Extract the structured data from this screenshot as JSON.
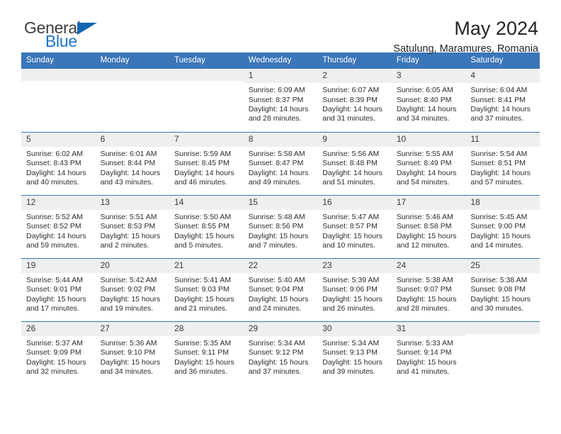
{
  "logo": {
    "word_one": "General",
    "word_two": "Blue",
    "triangle_icon": "triangle-icon",
    "color_dark": "#3c3c3c",
    "color_blue": "#1e74c4"
  },
  "header": {
    "title": "May 2024",
    "subtitle": "Satulung, Maramures, Romania"
  },
  "theme": {
    "header_blue": "#3a76b8",
    "daynum_bg": "#efefef",
    "text": "#2c2c2c"
  },
  "calendar": {
    "weekday_headers": [
      "Sunday",
      "Monday",
      "Tuesday",
      "Wednesday",
      "Thursday",
      "Friday",
      "Saturday"
    ],
    "labels": {
      "sunrise": "Sunrise:",
      "sunset": "Sunset:",
      "daylight": "Daylight:"
    },
    "weeks": [
      [
        {
          "day": "",
          "empty": true
        },
        {
          "day": "",
          "empty": true
        },
        {
          "day": "",
          "empty": true
        },
        {
          "day": "1",
          "sunrise": "Sunrise: 6:09 AM",
          "sunset": "Sunset: 8:37 PM",
          "daylight_1": "Daylight: 14 hours",
          "daylight_2": "and 28 minutes."
        },
        {
          "day": "2",
          "sunrise": "Sunrise: 6:07 AM",
          "sunset": "Sunset: 8:39 PM",
          "daylight_1": "Daylight: 14 hours",
          "daylight_2": "and 31 minutes."
        },
        {
          "day": "3",
          "sunrise": "Sunrise: 6:05 AM",
          "sunset": "Sunset: 8:40 PM",
          "daylight_1": "Daylight: 14 hours",
          "daylight_2": "and 34 minutes."
        },
        {
          "day": "4",
          "sunrise": "Sunrise: 6:04 AM",
          "sunset": "Sunset: 8:41 PM",
          "daylight_1": "Daylight: 14 hours",
          "daylight_2": "and 37 minutes."
        }
      ],
      [
        {
          "day": "5",
          "sunrise": "Sunrise: 6:02 AM",
          "sunset": "Sunset: 8:43 PM",
          "daylight_1": "Daylight: 14 hours",
          "daylight_2": "and 40 minutes."
        },
        {
          "day": "6",
          "sunrise": "Sunrise: 6:01 AM",
          "sunset": "Sunset: 8:44 PM",
          "daylight_1": "Daylight: 14 hours",
          "daylight_2": "and 43 minutes."
        },
        {
          "day": "7",
          "sunrise": "Sunrise: 5:59 AM",
          "sunset": "Sunset: 8:45 PM",
          "daylight_1": "Daylight: 14 hours",
          "daylight_2": "and 46 minutes."
        },
        {
          "day": "8",
          "sunrise": "Sunrise: 5:58 AM",
          "sunset": "Sunset: 8:47 PM",
          "daylight_1": "Daylight: 14 hours",
          "daylight_2": "and 49 minutes."
        },
        {
          "day": "9",
          "sunrise": "Sunrise: 5:56 AM",
          "sunset": "Sunset: 8:48 PM",
          "daylight_1": "Daylight: 14 hours",
          "daylight_2": "and 51 minutes."
        },
        {
          "day": "10",
          "sunrise": "Sunrise: 5:55 AM",
          "sunset": "Sunset: 8:49 PM",
          "daylight_1": "Daylight: 14 hours",
          "daylight_2": "and 54 minutes."
        },
        {
          "day": "11",
          "sunrise": "Sunrise: 5:54 AM",
          "sunset": "Sunset: 8:51 PM",
          "daylight_1": "Daylight: 14 hours",
          "daylight_2": "and 57 minutes."
        }
      ],
      [
        {
          "day": "12",
          "sunrise": "Sunrise: 5:52 AM",
          "sunset": "Sunset: 8:52 PM",
          "daylight_1": "Daylight: 14 hours",
          "daylight_2": "and 59 minutes."
        },
        {
          "day": "13",
          "sunrise": "Sunrise: 5:51 AM",
          "sunset": "Sunset: 8:53 PM",
          "daylight_1": "Daylight: 15 hours",
          "daylight_2": "and 2 minutes."
        },
        {
          "day": "14",
          "sunrise": "Sunrise: 5:50 AM",
          "sunset": "Sunset: 8:55 PM",
          "daylight_1": "Daylight: 15 hours",
          "daylight_2": "and 5 minutes."
        },
        {
          "day": "15",
          "sunrise": "Sunrise: 5:48 AM",
          "sunset": "Sunset: 8:56 PM",
          "daylight_1": "Daylight: 15 hours",
          "daylight_2": "and 7 minutes."
        },
        {
          "day": "16",
          "sunrise": "Sunrise: 5:47 AM",
          "sunset": "Sunset: 8:57 PM",
          "daylight_1": "Daylight: 15 hours",
          "daylight_2": "and 10 minutes."
        },
        {
          "day": "17",
          "sunrise": "Sunrise: 5:46 AM",
          "sunset": "Sunset: 8:58 PM",
          "daylight_1": "Daylight: 15 hours",
          "daylight_2": "and 12 minutes."
        },
        {
          "day": "18",
          "sunrise": "Sunrise: 5:45 AM",
          "sunset": "Sunset: 9:00 PM",
          "daylight_1": "Daylight: 15 hours",
          "daylight_2": "and 14 minutes."
        }
      ],
      [
        {
          "day": "19",
          "sunrise": "Sunrise: 5:44 AM",
          "sunset": "Sunset: 9:01 PM",
          "daylight_1": "Daylight: 15 hours",
          "daylight_2": "and 17 minutes."
        },
        {
          "day": "20",
          "sunrise": "Sunrise: 5:42 AM",
          "sunset": "Sunset: 9:02 PM",
          "daylight_1": "Daylight: 15 hours",
          "daylight_2": "and 19 minutes."
        },
        {
          "day": "21",
          "sunrise": "Sunrise: 5:41 AM",
          "sunset": "Sunset: 9:03 PM",
          "daylight_1": "Daylight: 15 hours",
          "daylight_2": "and 21 minutes."
        },
        {
          "day": "22",
          "sunrise": "Sunrise: 5:40 AM",
          "sunset": "Sunset: 9:04 PM",
          "daylight_1": "Daylight: 15 hours",
          "daylight_2": "and 24 minutes."
        },
        {
          "day": "23",
          "sunrise": "Sunrise: 5:39 AM",
          "sunset": "Sunset: 9:06 PM",
          "daylight_1": "Daylight: 15 hours",
          "daylight_2": "and 26 minutes."
        },
        {
          "day": "24",
          "sunrise": "Sunrise: 5:38 AM",
          "sunset": "Sunset: 9:07 PM",
          "daylight_1": "Daylight: 15 hours",
          "daylight_2": "and 28 minutes."
        },
        {
          "day": "25",
          "sunrise": "Sunrise: 5:38 AM",
          "sunset": "Sunset: 9:08 PM",
          "daylight_1": "Daylight: 15 hours",
          "daylight_2": "and 30 minutes."
        }
      ],
      [
        {
          "day": "26",
          "sunrise": "Sunrise: 5:37 AM",
          "sunset": "Sunset: 9:09 PM",
          "daylight_1": "Daylight: 15 hours",
          "daylight_2": "and 32 minutes."
        },
        {
          "day": "27",
          "sunrise": "Sunrise: 5:36 AM",
          "sunset": "Sunset: 9:10 PM",
          "daylight_1": "Daylight: 15 hours",
          "daylight_2": "and 34 minutes."
        },
        {
          "day": "28",
          "sunrise": "Sunrise: 5:35 AM",
          "sunset": "Sunset: 9:11 PM",
          "daylight_1": "Daylight: 15 hours",
          "daylight_2": "and 36 minutes."
        },
        {
          "day": "29",
          "sunrise": "Sunrise: 5:34 AM",
          "sunset": "Sunset: 9:12 PM",
          "daylight_1": "Daylight: 15 hours",
          "daylight_2": "and 37 minutes."
        },
        {
          "day": "30",
          "sunrise": "Sunrise: 5:34 AM",
          "sunset": "Sunset: 9:13 PM",
          "daylight_1": "Daylight: 15 hours",
          "daylight_2": "and 39 minutes."
        },
        {
          "day": "31",
          "sunrise": "Sunrise: 5:33 AM",
          "sunset": "Sunset: 9:14 PM",
          "daylight_1": "Daylight: 15 hours",
          "daylight_2": "and 41 minutes."
        },
        {
          "day": "",
          "empty": true
        }
      ]
    ]
  }
}
